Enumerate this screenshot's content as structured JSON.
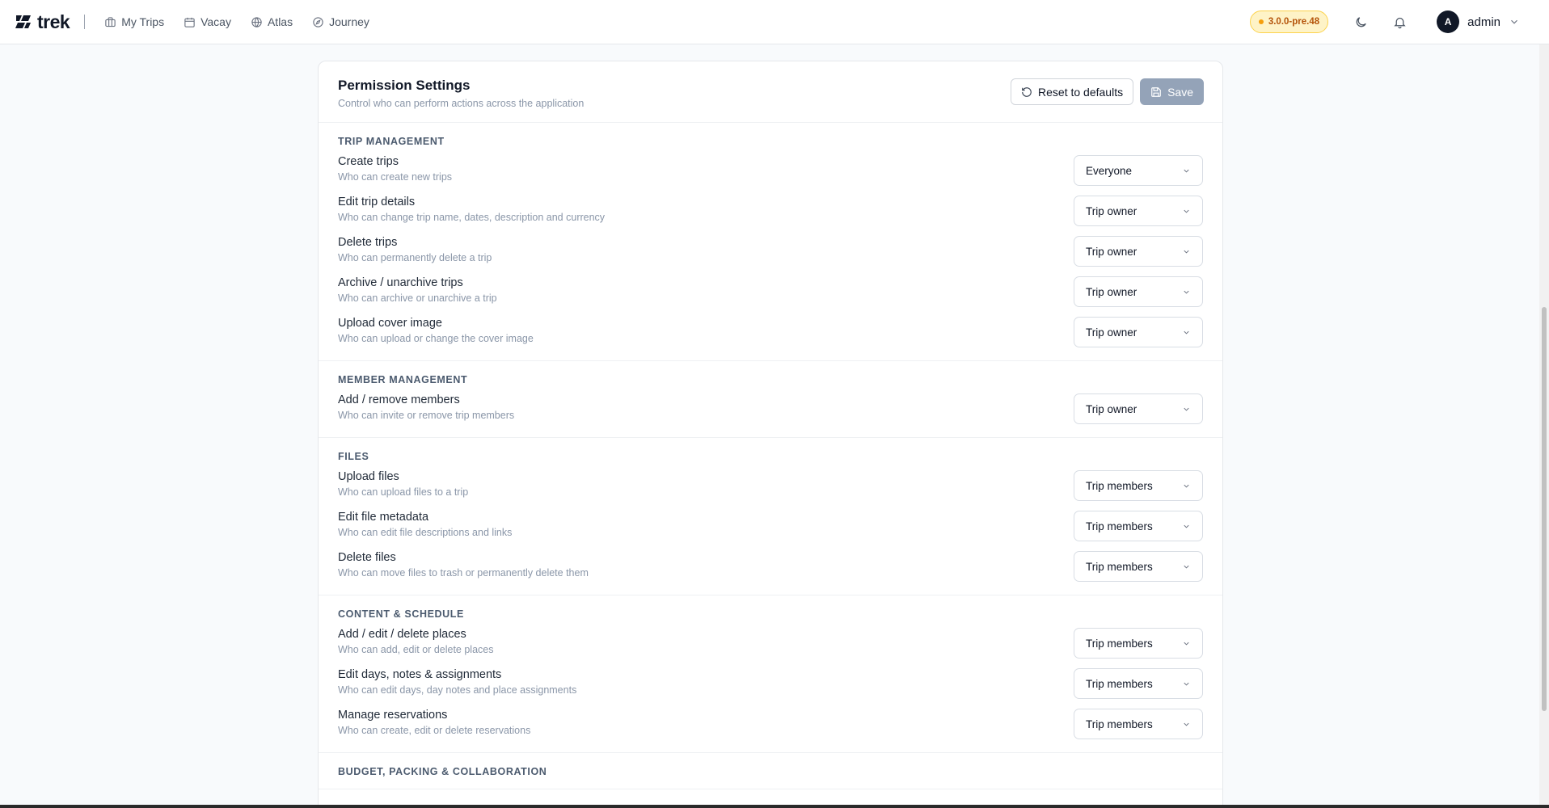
{
  "brand": {
    "name": "trek"
  },
  "nav": [
    {
      "label": "My Trips",
      "icon": "briefcase-icon"
    },
    {
      "label": "Vacay",
      "icon": "calendar-icon"
    },
    {
      "label": "Atlas",
      "icon": "globe-icon"
    },
    {
      "label": "Journey",
      "icon": "compass-icon"
    }
  ],
  "topbar": {
    "version": "3.0.0-pre.48",
    "user_initial": "A",
    "user_name": "admin"
  },
  "colors": {
    "accent_badge_bg": "#fef3c7",
    "accent_badge_text": "#b45309",
    "save_disabled": "#94a3b8"
  },
  "card": {
    "title": "Permission Settings",
    "subtitle": "Control who can perform actions across the application",
    "reset_label": "Reset to defaults",
    "save_label": "Save"
  },
  "sections": [
    {
      "title": "TRIP MANAGEMENT",
      "rows": [
        {
          "label": "Create trips",
          "desc": "Who can create new trips",
          "value": "Everyone"
        },
        {
          "label": "Edit trip details",
          "desc": "Who can change trip name, dates, description and currency",
          "value": "Trip owner"
        },
        {
          "label": "Delete trips",
          "desc": "Who can permanently delete a trip",
          "value": "Trip owner"
        },
        {
          "label": "Archive / unarchive trips",
          "desc": "Who can archive or unarchive a trip",
          "value": "Trip owner"
        },
        {
          "label": "Upload cover image",
          "desc": "Who can upload or change the cover image",
          "value": "Trip owner"
        }
      ]
    },
    {
      "title": "MEMBER MANAGEMENT",
      "rows": [
        {
          "label": "Add / remove members",
          "desc": "Who can invite or remove trip members",
          "value": "Trip owner"
        }
      ]
    },
    {
      "title": "FILES",
      "rows": [
        {
          "label": "Upload files",
          "desc": "Who can upload files to a trip",
          "value": "Trip members"
        },
        {
          "label": "Edit file metadata",
          "desc": "Who can edit file descriptions and links",
          "value": "Trip members"
        },
        {
          "label": "Delete files",
          "desc": "Who can move files to trash or permanently delete them",
          "value": "Trip members"
        }
      ]
    },
    {
      "title": "CONTENT & SCHEDULE",
      "rows": [
        {
          "label": "Add / edit / delete places",
          "desc": "Who can add, edit or delete places",
          "value": "Trip members"
        },
        {
          "label": "Edit days, notes & assignments",
          "desc": "Who can edit days, day notes and place assignments",
          "value": "Trip members"
        },
        {
          "label": "Manage reservations",
          "desc": "Who can create, edit or delete reservations",
          "value": "Trip members"
        }
      ]
    },
    {
      "title": "BUDGET, PACKING & COLLABORATION",
      "rows": []
    }
  ]
}
